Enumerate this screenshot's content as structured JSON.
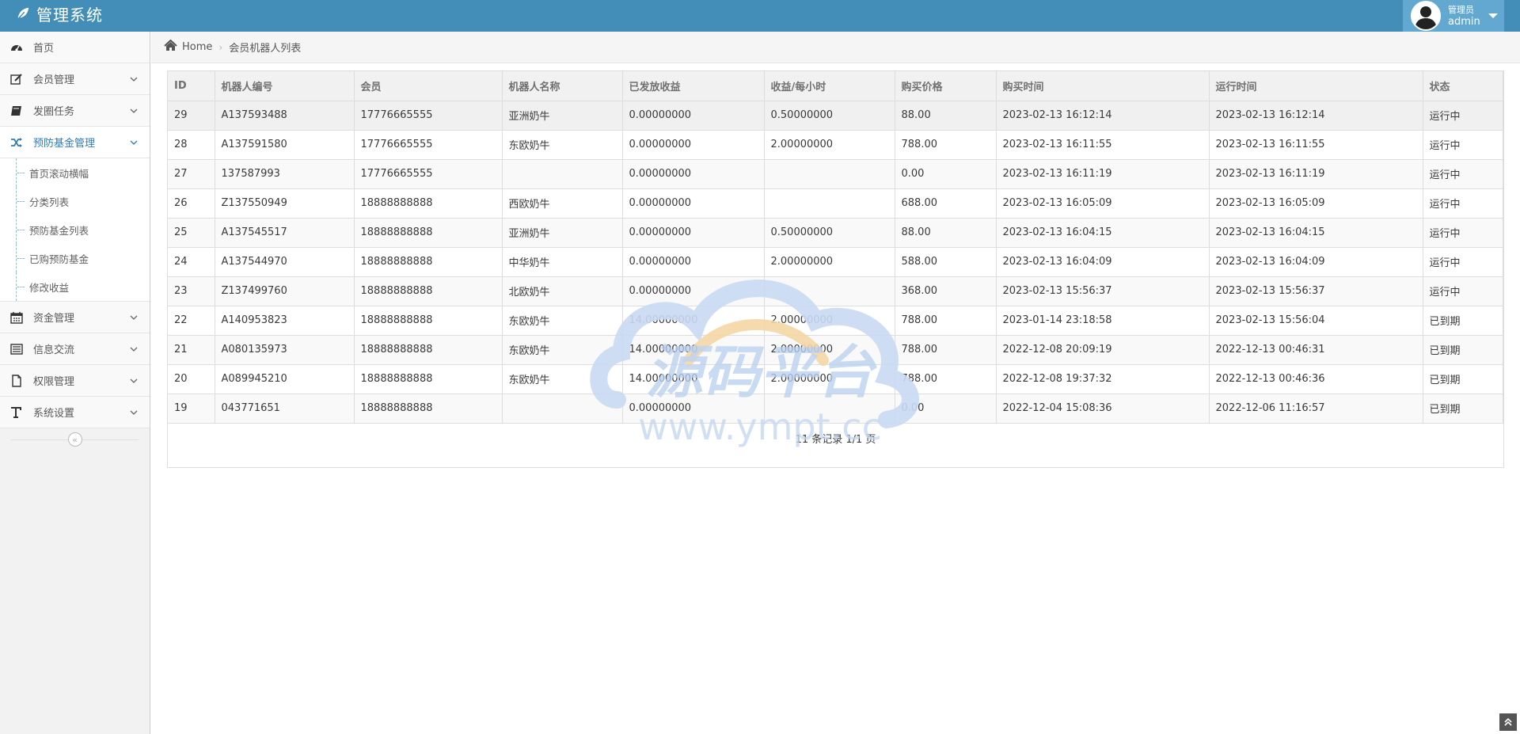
{
  "app": {
    "title": "管理系统"
  },
  "user": {
    "role": "管理员",
    "name": "admin"
  },
  "sidebar": {
    "items": [
      {
        "label": "首页",
        "icon": "dashboard-icon",
        "has_children": false
      },
      {
        "label": "会员管理",
        "icon": "edit-icon",
        "has_children": true
      },
      {
        "label": "发圈任务",
        "icon": "book-icon",
        "has_children": true
      },
      {
        "label": "预防基金管理",
        "icon": "random-icon",
        "has_children": true,
        "active": true,
        "children": [
          "首页滚动横幅",
          "分类列表",
          "预防基金列表",
          "已购预防基金",
          "修改收益"
        ]
      },
      {
        "label": "资金管理",
        "icon": "calendar-icon",
        "has_children": true
      },
      {
        "label": "信息交流",
        "icon": "list-alt-icon",
        "has_children": true
      },
      {
        "label": "权限管理",
        "icon": "file-icon",
        "has_children": true
      },
      {
        "label": "系统设置",
        "icon": "text-height-icon",
        "has_children": true
      }
    ],
    "collapse_glyph": "«"
  },
  "breadcrumb": {
    "home": "Home",
    "current": "会员机器人列表"
  },
  "table": {
    "headers": [
      "ID",
      "机器人编号",
      "会员",
      "机器人名称",
      "已发放收益",
      "收益/每小时",
      "购买价格",
      "购买时间",
      "运行时间",
      "状态"
    ],
    "rows": [
      [
        "29",
        "A137593488",
        "17776665555",
        "亚洲奶牛",
        "0.00000000",
        "0.50000000",
        "88.00",
        "2023-02-13 16:12:14",
        "2023-02-13 16:12:14",
        "运行中"
      ],
      [
        "28",
        "A137591580",
        "17776665555",
        "东欧奶牛",
        "0.00000000",
        "2.00000000",
        "788.00",
        "2023-02-13 16:11:55",
        "2023-02-13 16:11:55",
        "运行中"
      ],
      [
        "27",
        "137587993",
        "17776665555",
        "",
        "0.00000000",
        "",
        "0.00",
        "2023-02-13 16:11:19",
        "2023-02-13 16:11:19",
        "运行中"
      ],
      [
        "26",
        "Z137550949",
        "18888888888",
        "西欧奶牛",
        "0.00000000",
        "",
        "688.00",
        "2023-02-13 16:05:09",
        "2023-02-13 16:05:09",
        "运行中"
      ],
      [
        "25",
        "A137545517",
        "18888888888",
        "亚洲奶牛",
        "0.00000000",
        "0.50000000",
        "88.00",
        "2023-02-13 16:04:15",
        "2023-02-13 16:04:15",
        "运行中"
      ],
      [
        "24",
        "A137544970",
        "18888888888",
        "中华奶牛",
        "0.00000000",
        "2.00000000",
        "588.00",
        "2023-02-13 16:04:09",
        "2023-02-13 16:04:09",
        "运行中"
      ],
      [
        "23",
        "Z137499760",
        "18888888888",
        "北欧奶牛",
        "0.00000000",
        "",
        "368.00",
        "2023-02-13 15:56:37",
        "2023-02-13 15:56:37",
        "运行中"
      ],
      [
        "22",
        "A140953823",
        "18888888888",
        "东欧奶牛",
        "14.00000000",
        "2.00000000",
        "788.00",
        "2023-01-14 23:18:58",
        "2023-02-13 15:56:04",
        "已到期"
      ],
      [
        "21",
        "A080135973",
        "18888888888",
        "东欧奶牛",
        "14.00000000",
        "2.00000000",
        "788.00",
        "2022-12-08 20:09:19",
        "2022-12-13 00:46:31",
        "已到期"
      ],
      [
        "20",
        "A089945210",
        "18888888888",
        "东欧奶牛",
        "14.00000000",
        "2.00000000",
        "788.00",
        "2022-12-08 19:37:32",
        "2022-12-13 00:46:36",
        "已到期"
      ],
      [
        "19",
        "043771651",
        "18888888888",
        "",
        "0.00000000",
        "",
        "0.00",
        "2022-12-04 15:08:36",
        "2022-12-06 11:16:57",
        "已到期"
      ]
    ],
    "pager": "11 条记录 1/1 页"
  },
  "watermark": {
    "text": "源码平台",
    "url": "www.ympt.cc"
  },
  "colors": {
    "header": "#438eb9",
    "user_box": "#62a8d1",
    "active_link": "#2b7dbc"
  }
}
